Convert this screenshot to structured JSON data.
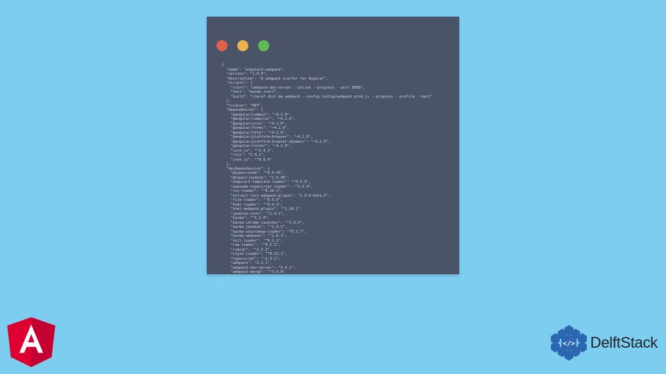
{
  "terminal": {
    "traffic": {
      "red": "red",
      "yellow": "yellow",
      "green": "green"
    },
    "code_lines": [
      "{",
      "  \"name\": \"angular2-webpack\",",
      "  \"version\": \"1.0.0\",",
      "  \"description\": \"A webpack starter for Angular\",",
      "  \"scripts\": {",
      "    \"start\": \"webpack-dev-server --inline --progress --port 8080\",",
      "    \"test\": \"karma start\",",
      "    \"build\": \"rimraf dist && webpack --config config/webpack.prod.js --progress --profile --bail\"",
      "  },",
      "  \"license\": \"MIT\",",
      "  \"dependencies\": {",
      "    \"@angular/common\": \"~4.2.0\",",
      "    \"@angular/compiler\": \"~4.2.0\",",
      "    \"@angular/core\": \"~4.2.0\",",
      "    \"@angular/forms\": \"~4.2.0\",",
      "    \"@angular/http\": \"~4.2.0\",",
      "    \"@angular/platform-browser\": \"~4.2.0\",",
      "    \"@angular/platform-browser-dynamic\": \"~4.2.0\",",
      "    \"@angular/router\": \"~4.2.0\",",
      "    \"core-js\": \"^2.4.1\",",
      "    \"rxjs\": \"5.0.1\",",
      "    \"zone.js\": \"^0.8.4\"",
      "  },",
      "  \"devDependencies\": {",
      "    \"@types/node\": \"^6.0.45\",",
      "    \"@types/jasmine\": \"2.5.36\",",
      "    \"angular2-template-loader\": \"^0.6.0\",",
      "    \"awesome-typescript-loader\": \"^3.0.4\",",
      "    \"css-loader\": \"^0.26.1\",",
      "    \"extract-text-webpack-plugin\": \"2.0.0-beta.5\",",
      "    \"file-loader\": \"^0.9.0\",",
      "    \"html-loader\": \"^0.4.3\",",
      "    \"html-webpack-plugin\": \"^2.16.1\",",
      "    \"jasmine-core\": \"^2.4.1\",",
      "    \"karma\": \"^1.2.0\",",
      "    \"karma-chrome-launcher\": \"^2.0.0\",",
      "    \"karma-jasmine\": \"^1.0.2\",",
      "    \"karma-sourcemap-loader\": \"^0.3.7\",",
      "    \"karma-webpack\": \"^2.0.1\",",
      "    \"null-loader\": \"^0.1.1\",",
      "    \"raw-loader\": \"^0.5.1\",",
      "    \"rimraf\": \"^2.5.2\",",
      "    \"style-loader\": \"^0.13.1\",",
      "    \"typescript\": \"~2.3.1\",",
      "    \"webpack\": \"2.2.1\",",
      "    \"webpack-dev-server\": \"2.4.1\",",
      "    \"webpack-merge\": \"^3.0.0\"",
      "  }",
      "}"
    ]
  },
  "logos": {
    "angular_letter": "A",
    "delftstack_text": "DelftStack",
    "delftstack_code": "</>"
  },
  "colors": {
    "bg": "#7dcdf0",
    "terminal": "#4a5368",
    "angular": "#dd0031",
    "angular_dark": "#c3002f",
    "delft_blue": "#2d66b1"
  }
}
